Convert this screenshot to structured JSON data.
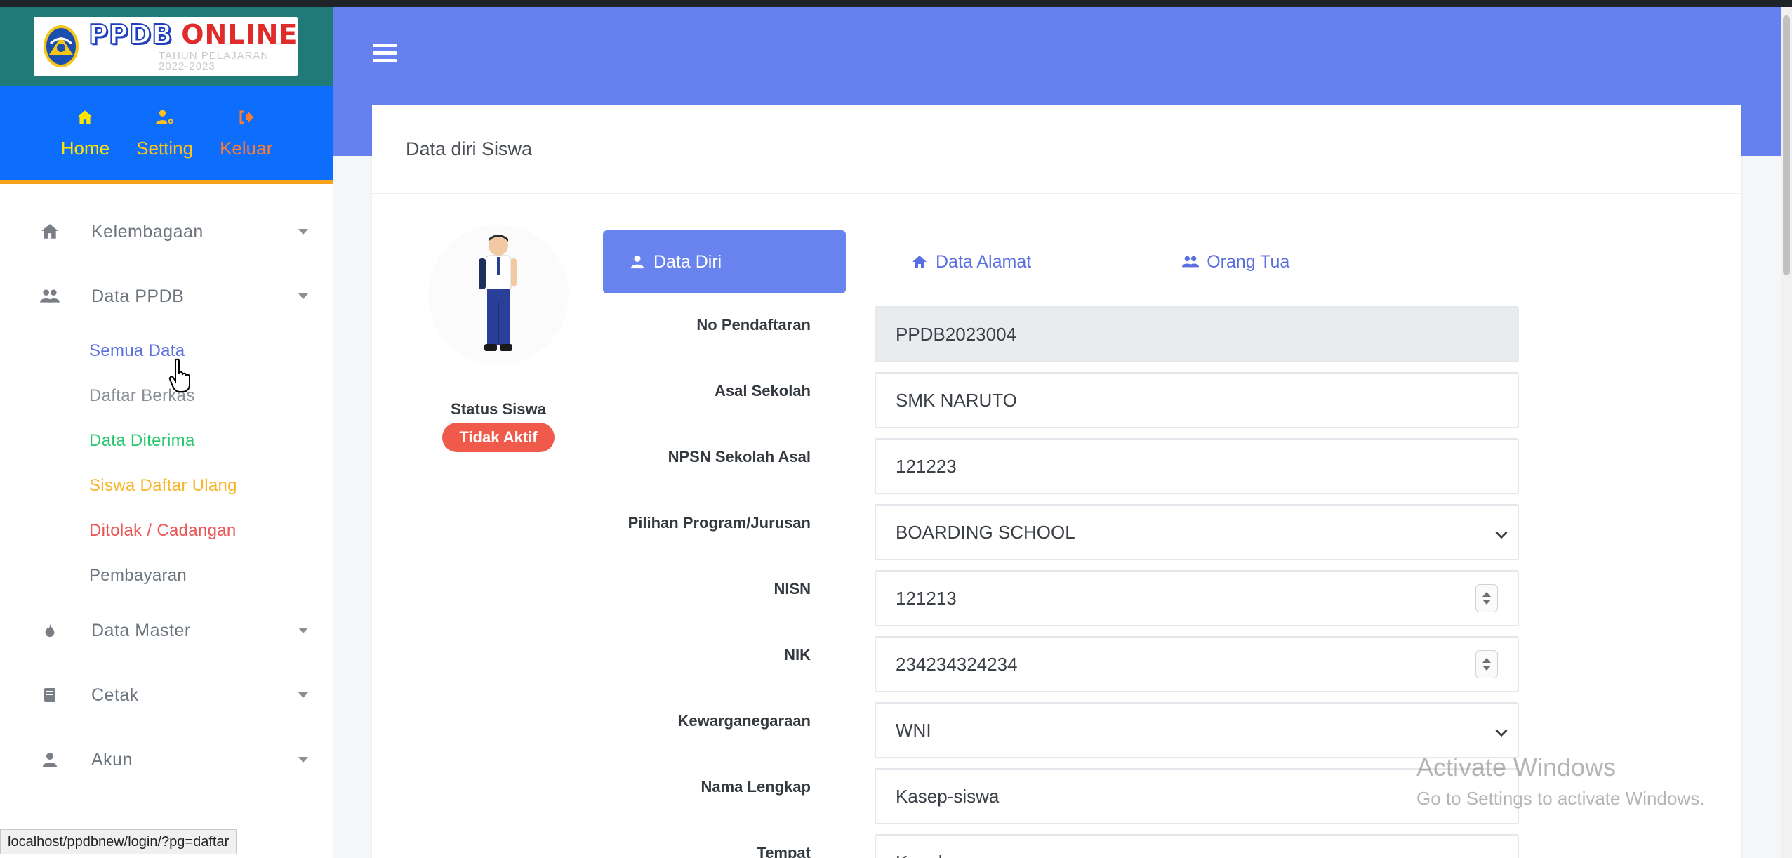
{
  "brand": {
    "title_part1": "PPDB",
    "title_part2": "ONLINE",
    "subtitle": "TAHUN PELAJARAN 2022-2023"
  },
  "top_nav": [
    {
      "label": "Home",
      "icon": "home-icon"
    },
    {
      "label": "Setting",
      "icon": "user-cog-icon"
    },
    {
      "label": "Keluar",
      "icon": "sign-out-icon"
    }
  ],
  "menu": {
    "kelembagaan": "Kelembagaan",
    "data_ppdb": "Data PPDB",
    "submenu": [
      {
        "label": "Semua Data",
        "color": "#5a6fe0"
      },
      {
        "label": "Daftar Berkas",
        "color": "#8a8f95"
      },
      {
        "label": "Data Diterima",
        "color": "#28c76f"
      },
      {
        "label": "Siswa Daftar Ulang",
        "color": "#f7b529"
      },
      {
        "label": "Ditolak / Cadangan",
        "color": "#ea5455"
      },
      {
        "label": "Pembayaran",
        "color": "#6c757d"
      }
    ],
    "data_master": "Data Master",
    "cetak": "Cetak",
    "akun": "Akun"
  },
  "status_url": "localhost/ppdbnew/login/?pg=daftar",
  "card": {
    "title": "Data diri Siswa"
  },
  "profile": {
    "status_label": "Status Siswa",
    "status_badge": "Tidak Aktif"
  },
  "tabs": [
    {
      "label": "Data Diri",
      "icon": "user-icon",
      "active": true
    },
    {
      "label": "Data Alamat",
      "icon": "home-icon",
      "active": false
    },
    {
      "label": "Orang Tua",
      "icon": "users-icon",
      "active": false
    }
  ],
  "form": {
    "no_pendaftaran": {
      "label": "No Pendaftaran",
      "value": "PPDB2023004"
    },
    "asal_sekolah": {
      "label": "Asal Sekolah",
      "value": "SMK NARUTO"
    },
    "npsn": {
      "label": "NPSN Sekolah Asal",
      "value": "121223"
    },
    "program": {
      "label": "Pilihan Program/Jurusan",
      "value": "BOARDING SCHOOL"
    },
    "nisn": {
      "label": "NISN",
      "value": "121213"
    },
    "nik": {
      "label": "NIK",
      "value": "234234324234"
    },
    "kewarganegaraan": {
      "label": "Kewarganegaraan",
      "value": "WNI"
    },
    "nama": {
      "label": "Nama Lengkap",
      "value": "Kasep-siswa"
    },
    "tempat": {
      "label": "Tempat",
      "value": "Kenoha"
    }
  },
  "watermark": {
    "line1": "Activate Windows",
    "line2": "Go to Settings to activate Windows."
  }
}
